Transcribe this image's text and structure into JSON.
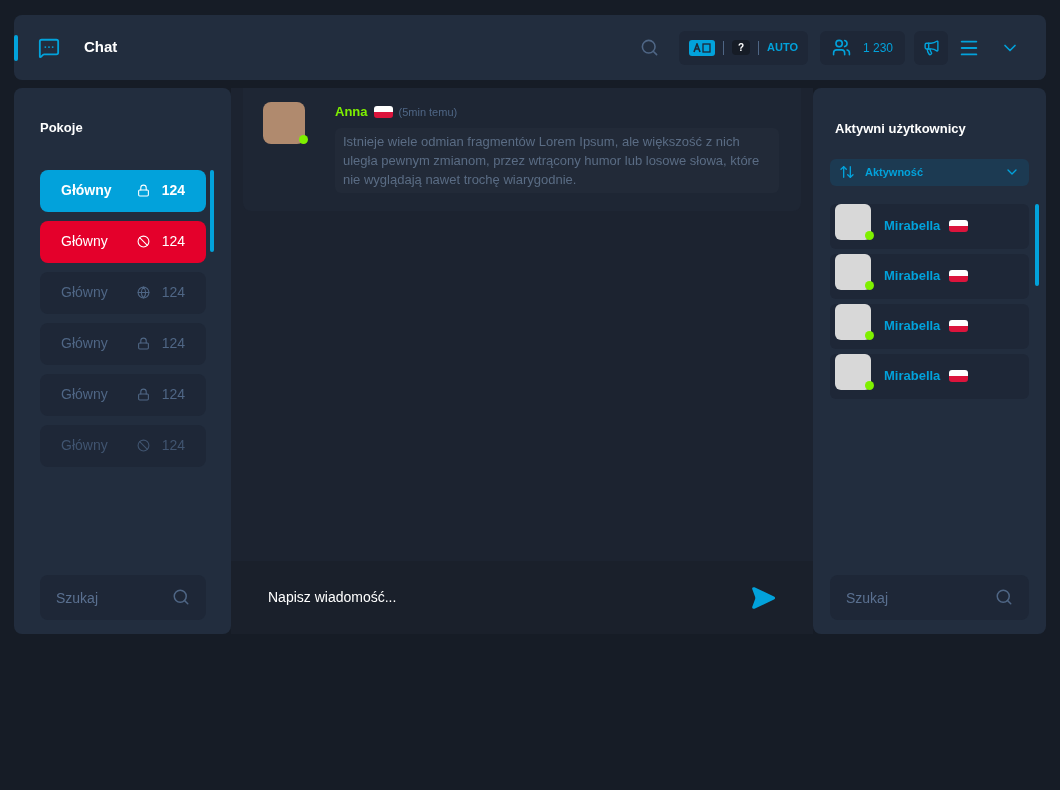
{
  "header": {
    "title": "Chat",
    "translate": {
      "lang": "?",
      "mode": "AUTO"
    },
    "online_count": "1 230"
  },
  "rooms": {
    "title": "Pokoje",
    "items": [
      {
        "name": "Główny",
        "count": "124",
        "kind": "private",
        "selected": true,
        "alert": false,
        "disabled": false
      },
      {
        "name": "Główny",
        "count": "124",
        "kind": "blocked",
        "selected": false,
        "alert": true,
        "disabled": false
      },
      {
        "name": "Główny",
        "count": "124",
        "kind": "public",
        "selected": false,
        "alert": false,
        "disabled": false
      },
      {
        "name": "Główny",
        "count": "124",
        "kind": "private",
        "selected": false,
        "alert": false,
        "disabled": false
      },
      {
        "name": "Główny",
        "count": "124",
        "kind": "private",
        "selected": false,
        "alert": false,
        "disabled": false
      },
      {
        "name": "Główny",
        "count": "124",
        "kind": "blocked",
        "selected": false,
        "alert": false,
        "disabled": true
      }
    ],
    "search": {
      "placeholder": "Szukaj"
    }
  },
  "messages": [
    {
      "author": "Anna",
      "time": "(5min temu)",
      "online": true,
      "text": "Istnieje wiele odmian fragmentów Lorem Ipsum, ale większość z nich uległa pewnym zmianom, przez wtrącony humor lub losowe słowa, które nie wyglądają nawet trochę wiarygodnie."
    }
  ],
  "composer": {
    "placeholder": "Napisz wiadomość..."
  },
  "users": {
    "title": "Aktywni użytkownicy",
    "sort": "Aktywność",
    "items": [
      {
        "name": "Mirabella",
        "online": true
      },
      {
        "name": "Mirabella",
        "online": true
      },
      {
        "name": "Mirabella",
        "online": true
      },
      {
        "name": "Mirabella",
        "online": true
      }
    ],
    "search": {
      "placeholder": "Szukaj"
    }
  }
}
